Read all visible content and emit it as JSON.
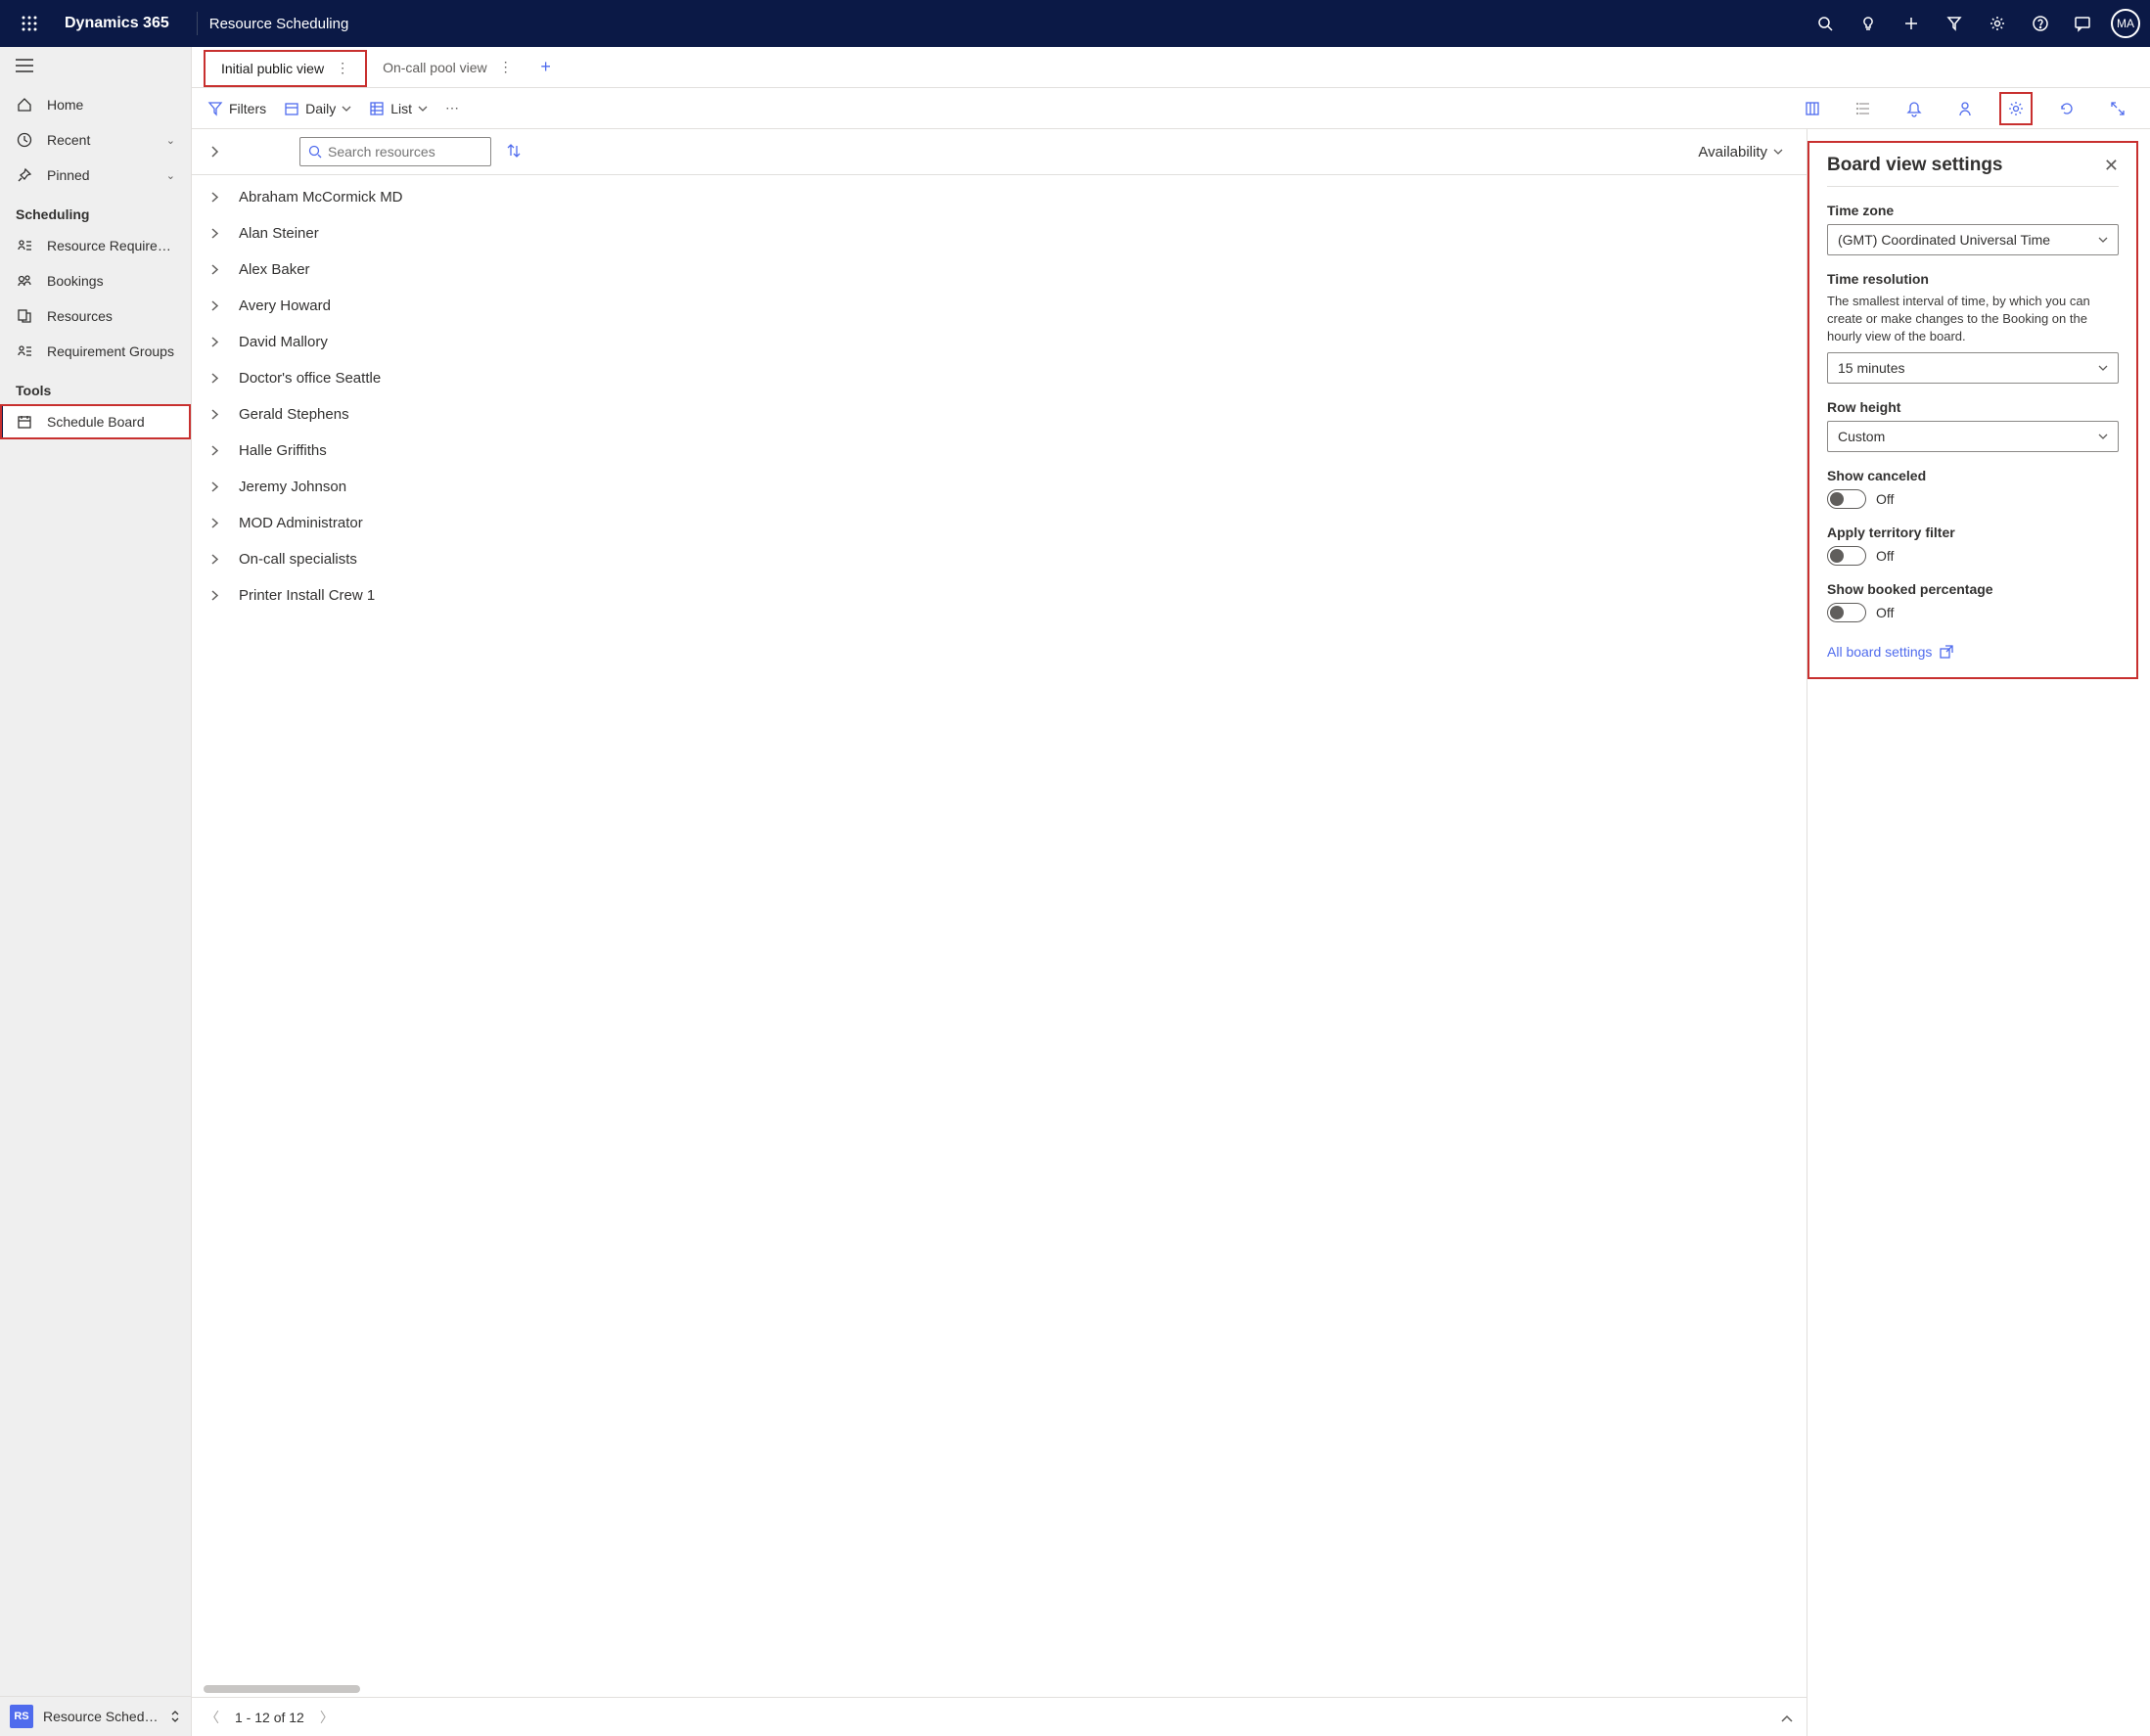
{
  "header": {
    "brand": "Dynamics 365",
    "page_title": "Resource Scheduling",
    "avatar": "MA"
  },
  "sidebar": {
    "nav": [
      {
        "label": "Home",
        "chevron": false
      },
      {
        "label": "Recent",
        "chevron": true
      },
      {
        "label": "Pinned",
        "chevron": true
      }
    ],
    "scheduling_header": "Scheduling",
    "scheduling": [
      {
        "label": "Resource Requireme…"
      },
      {
        "label": "Bookings"
      },
      {
        "label": "Resources"
      },
      {
        "label": "Requirement Groups"
      }
    ],
    "tools_header": "Tools",
    "tools": [
      {
        "label": "Schedule Board",
        "selected": true
      }
    ],
    "footer_badge": "RS",
    "footer_label": "Resource Schedul…"
  },
  "tabs": {
    "items": [
      {
        "label": "Initial public view",
        "active": true
      },
      {
        "label": "On-call pool view",
        "active": false
      }
    ]
  },
  "toolbar": {
    "filters": "Filters",
    "daily": "Daily",
    "list": "List"
  },
  "search": {
    "placeholder": "Search resources",
    "availability": "Availability"
  },
  "resources": [
    "Abraham McCormick MD",
    "Alan Steiner",
    "Alex Baker",
    "Avery Howard",
    "David Mallory",
    "Doctor's office Seattle",
    "Gerald Stephens",
    "Halle Griffiths",
    "Jeremy Johnson",
    "MOD Administrator",
    "On-call specialists",
    "Printer Install Crew 1"
  ],
  "pager": {
    "range": "1 - 12 of 12"
  },
  "settings_panel": {
    "title": "Board view settings",
    "time_zone_label": "Time zone",
    "time_zone_value": "(GMT) Coordinated Universal Time",
    "time_resolution_label": "Time resolution",
    "time_resolution_desc": "The smallest interval of time, by which you can create or make changes to the Booking on the hourly view of the board.",
    "time_resolution_value": "15 minutes",
    "row_height_label": "Row height",
    "row_height_value": "Custom",
    "show_canceled_label": "Show canceled",
    "show_canceled_state": "Off",
    "territory_filter_label": "Apply territory filter",
    "territory_filter_state": "Off",
    "show_booked_label": "Show booked percentage",
    "show_booked_state": "Off",
    "all_settings": "All board settings"
  }
}
